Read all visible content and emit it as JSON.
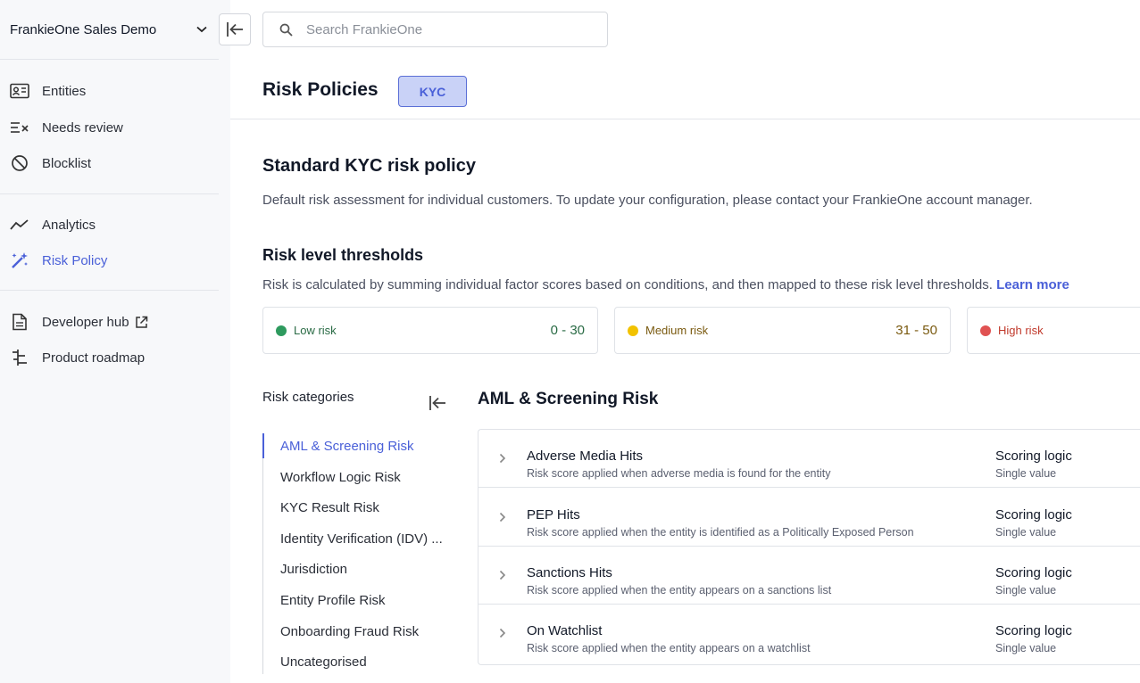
{
  "sidebar": {
    "org_name": "FrankieOne Sales Demo",
    "items": [
      {
        "label": "Entities",
        "icon": "id-card-icon"
      },
      {
        "label": "Needs review",
        "icon": "review-list-icon"
      },
      {
        "label": "Blocklist",
        "icon": "block-icon"
      },
      {
        "label": "Analytics",
        "icon": "trend-line-icon"
      },
      {
        "label": "Risk Policy",
        "icon": "magic-wand-icon",
        "active": true
      },
      {
        "label": "Developer hub",
        "icon": "document-icon"
      },
      {
        "label": "Product roadmap",
        "icon": "roadmap-icon"
      }
    ]
  },
  "search": {
    "placeholder": "Search FrankieOne"
  },
  "header": {
    "title": "Risk Policies",
    "badge": "KYC"
  },
  "policy": {
    "title": "Standard KYC risk policy",
    "description": "Default risk assessment for individual customers. To update your configuration, please contact your FrankieOne account manager."
  },
  "thresholds": {
    "title": "Risk level thresholds",
    "description": "Risk is calculated by summing individual factor scores based on conditions, and then mapped to these risk level thresholds.",
    "link": "Learn more",
    "levels": [
      {
        "label": "Low risk",
        "range": "0 - 30",
        "color": "#2e9a5e",
        "text_color": "#2a6b45"
      },
      {
        "label": "Medium risk",
        "range": "31 - 50",
        "color": "#f2c200",
        "text_color": "#7a5a10"
      },
      {
        "label": "High risk",
        "range": "",
        "color": "#e05252",
        "text_color": "#c0392b"
      }
    ]
  },
  "categories": {
    "title": "Risk categories",
    "items": [
      {
        "label": "AML & Screening Risk",
        "active": true
      },
      {
        "label": "Workflow Logic Risk"
      },
      {
        "label": "KYC Result Risk"
      },
      {
        "label": "Identity Verification (IDV) ..."
      },
      {
        "label": "Jurisdiction"
      },
      {
        "label": "Entity Profile Risk"
      },
      {
        "label": "Onboarding Fraud Risk"
      },
      {
        "label": "Uncategorised"
      }
    ]
  },
  "section": {
    "title": "AML & Screening Risk",
    "factors": [
      {
        "name": "Adverse Media Hits",
        "desc": "Risk score applied when adverse media is found for the entity",
        "logic_label": "Scoring logic",
        "logic_value": "Single value"
      },
      {
        "name": "PEP Hits",
        "desc": "Risk score applied when the entity is identified as a Politically Exposed Person",
        "logic_label": "Scoring logic",
        "logic_value": "Single value"
      },
      {
        "name": "Sanctions Hits",
        "desc": "Risk score applied when the entity appears on a sanctions list",
        "logic_label": "Scoring logic",
        "logic_value": "Single value"
      },
      {
        "name": "On Watchlist",
        "desc": "Risk score applied when the entity appears on a watchlist",
        "logic_label": "Scoring logic",
        "logic_value": "Single value"
      }
    ]
  }
}
